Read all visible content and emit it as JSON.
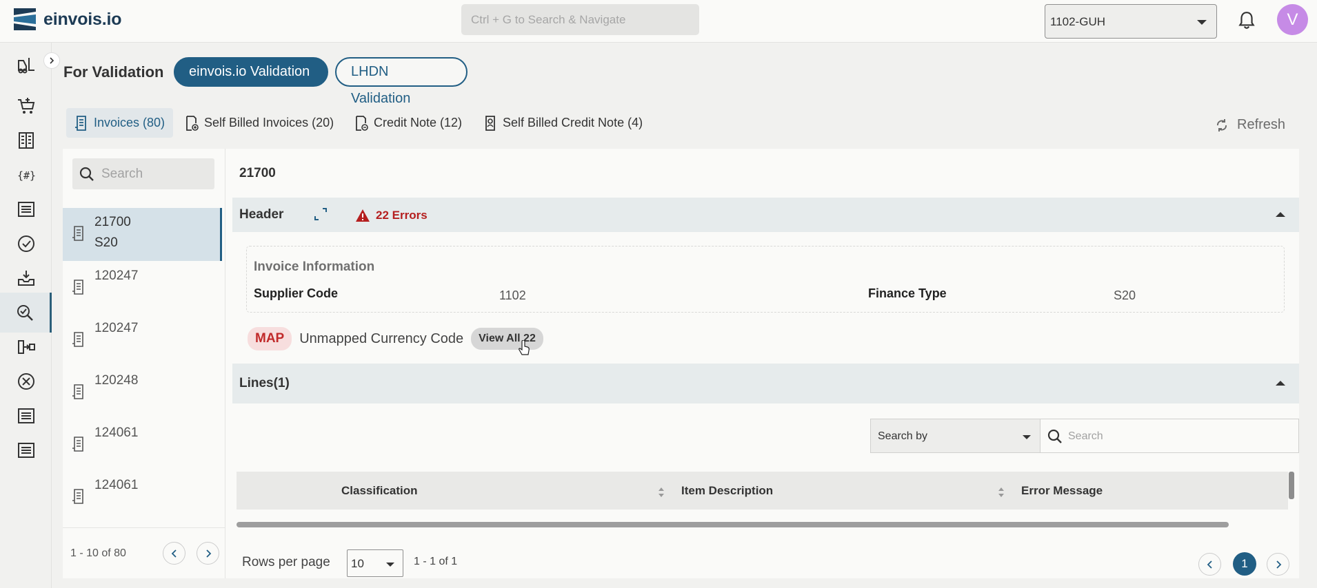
{
  "app": {
    "name": "einvois.io"
  },
  "topbar": {
    "search_placeholder": "Ctrl + G to Search & Navigate",
    "company": "1102-GUH",
    "avatar_initial": "V"
  },
  "page": {
    "title": "For Validation",
    "toggle_primary": "einvois.io Validation",
    "toggle_secondary": "LHDN Validation"
  },
  "tabs": [
    {
      "label": "Invoices (80)"
    },
    {
      "label": "Self Billed Invoices (20)"
    },
    {
      "label": "Credit Note (12)"
    },
    {
      "label": "Self Billed Credit Note (4)"
    }
  ],
  "refresh_label": "Refresh",
  "list": {
    "search_placeholder": "Search",
    "items": [
      {
        "number": "21700",
        "sub": "S20"
      },
      {
        "number": "120247"
      },
      {
        "number": "120247"
      },
      {
        "number": "120248"
      },
      {
        "number": "124061"
      },
      {
        "number": "124061"
      }
    ],
    "range": "1 - 10 of 80"
  },
  "detail": {
    "title": "21700",
    "header_label": "Header",
    "errors_label": "22 Errors",
    "invoice_info": {
      "title": "Invoice Information",
      "supplier_code_label": "Supplier Code",
      "supplier_code": "1102",
      "finance_type_label": "Finance Type",
      "finance_type": "S20"
    },
    "map_tag": "MAP",
    "map_message": "Unmapped Currency Code",
    "view_all": "View All 22",
    "lines_label": "Lines(1)",
    "search_by": "Search by",
    "search_placeholder": "Search",
    "columns": [
      "Classification",
      "Item Description",
      "Error Message"
    ],
    "rows_per_page_label": "Rows per page",
    "rows_per_page": "10",
    "page_range": "1 - 1 of 1",
    "current_page": "1"
  },
  "colors": {
    "primary": "#215e84",
    "error": "#b51f1f",
    "avatar": "#c68be6"
  },
  "icons": [
    "menu-logo",
    "bell-icon",
    "search-icon",
    "doc-icon",
    "refresh-icon",
    "expand-icon",
    "warning-icon",
    "chevron-left-icon",
    "chevron-right-icon"
  ]
}
